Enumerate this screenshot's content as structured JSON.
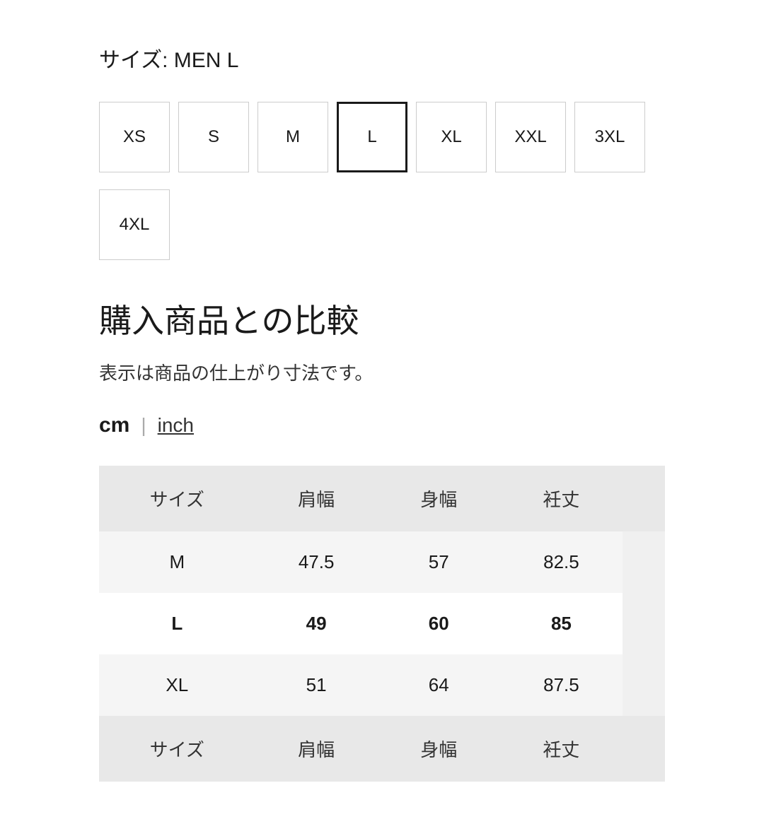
{
  "header": {
    "size_label": "サイズ: MEN L"
  },
  "size_selector": {
    "sizes": [
      {
        "label": "XS",
        "active": false
      },
      {
        "label": "S",
        "active": false
      },
      {
        "label": "M",
        "active": false
      },
      {
        "label": "L",
        "active": true
      },
      {
        "label": "XL",
        "active": false
      },
      {
        "label": "XXL",
        "active": false
      },
      {
        "label": "3XL",
        "active": false
      },
      {
        "label": "4XL",
        "active": false,
        "row2": true
      }
    ]
  },
  "comparison": {
    "title": "購入商品との比較",
    "description": "表示は商品の仕上がり寸法です。",
    "unit_cm": "cm",
    "unit_divider": "|",
    "unit_inch": "inch"
  },
  "table": {
    "headers": [
      "サイズ",
      "肩幅",
      "身幅",
      "衽丈"
    ],
    "rows": [
      {
        "size": "M",
        "col1": "47.5",
        "col2": "57",
        "col3": "82.5",
        "highlight": false
      },
      {
        "size": "L",
        "col1": "49",
        "col2": "60",
        "col3": "85",
        "highlight": true
      },
      {
        "size": "XL",
        "col1": "51",
        "col2": "64",
        "col3": "87.5",
        "highlight": false
      }
    ],
    "footer": [
      "サイズ",
      "肩幅",
      "身幅",
      "衽丈"
    ]
  }
}
